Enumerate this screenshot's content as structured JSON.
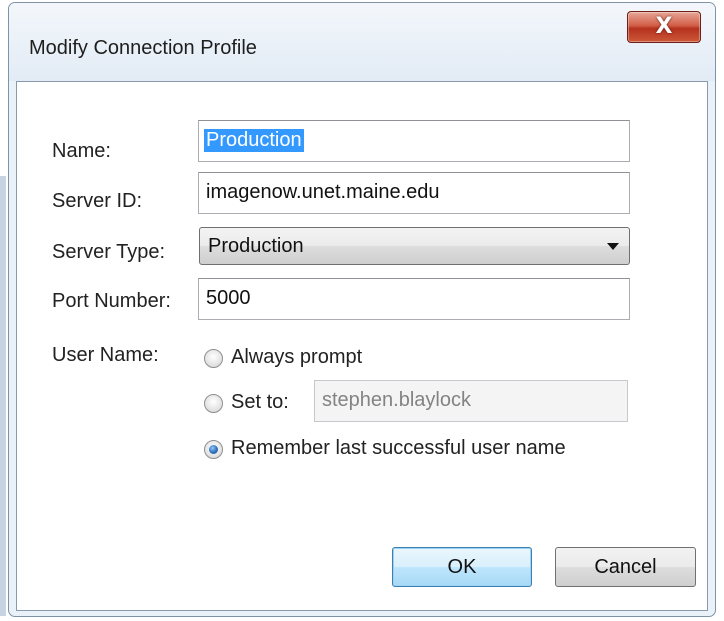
{
  "window": {
    "title": "Modify Connection Profile",
    "close_label": "X"
  },
  "form": {
    "name": {
      "label": "Name:",
      "value": "Production"
    },
    "server_id": {
      "label": "Server ID:",
      "value": "imagenow.unet.maine.edu"
    },
    "server_type": {
      "label": "Server Type:",
      "value": "Production"
    },
    "port": {
      "label": "Port Number:",
      "value": "5000"
    },
    "user_name": {
      "label": "User Name:",
      "options": {
        "always_prompt": "Always prompt",
        "set_to": "Set to:",
        "remember": "Remember last successful user name"
      },
      "set_to_value": "stephen.blaylock",
      "selected": "remember"
    }
  },
  "buttons": {
    "ok": "OK",
    "cancel": "Cancel"
  }
}
